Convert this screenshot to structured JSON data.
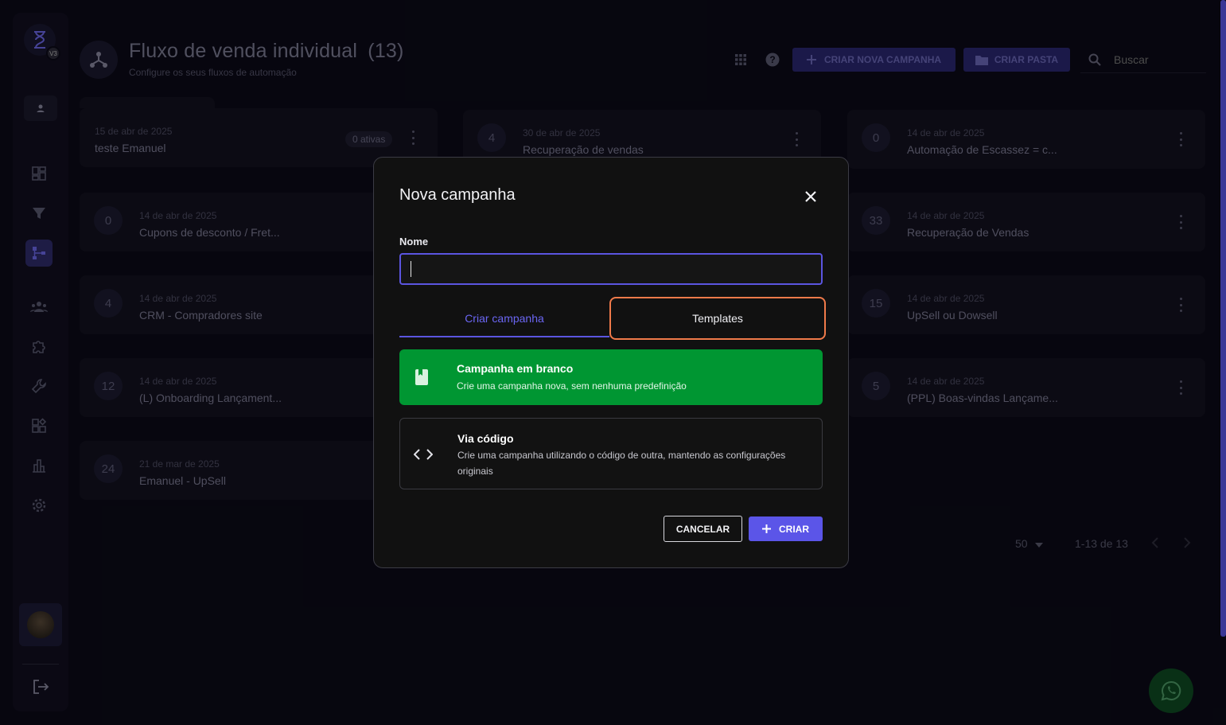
{
  "header": {
    "title": "Fluxo de venda individual",
    "count": "(13)",
    "subtitle": "Configure os seus fluxos de automação",
    "new_campaign_label": "CRIAR NOVA CAMPANHA",
    "new_folder_label": "CRIAR PASTA",
    "search_placeholder": "Buscar"
  },
  "sidebar": {
    "logo_badge": "V3",
    "items": [
      {
        "icon": "dashboard-icon",
        "active": false
      },
      {
        "icon": "funnel-icon",
        "active": false
      },
      {
        "icon": "flow-icon",
        "active": true
      },
      {
        "icon": "people-icon",
        "active": false
      },
      {
        "icon": "puzzle-icon",
        "active": false
      },
      {
        "icon": "wrench-icon",
        "active": false
      },
      {
        "icon": "widgets-icon",
        "active": false
      },
      {
        "icon": "bar-chart-icon",
        "active": false
      },
      {
        "icon": "gear-icon",
        "active": false
      }
    ]
  },
  "cards": [
    {
      "date": "15 de abr de 2025",
      "name": "teste Emanuel",
      "tag": "0 ativas"
    },
    {
      "count": "4",
      "date": "30 de abr de 2025",
      "name": "Recuperação de vendas"
    },
    {
      "count": "0",
      "date": "14 de abr de 2025",
      "name": "Automação de Escassez = c..."
    },
    {
      "count": "0",
      "date": "14 de abr de 2025",
      "name": "Cupons de desconto / Fret..."
    },
    {
      "count": "33",
      "date": "14 de abr de 2025",
      "name": "Recuperação de Vendas"
    },
    {
      "count": "4",
      "date": "14 de abr de 2025",
      "name": "CRM - Compradores site"
    },
    {
      "count": "15",
      "date": "14 de abr de 2025",
      "name": "UpSell ou Dowsell"
    },
    {
      "count": "12",
      "date": "14 de abr de 2025",
      "name": "(L) Onboarding Lançament..."
    },
    {
      "count": "5",
      "date": "14 de abr de 2025",
      "name": "(PPL) Boas-vindas Lançame..."
    },
    {
      "count": "24",
      "date": "21 de mar de 2025",
      "name": "Emanuel - UpSell"
    }
  ],
  "pagination": {
    "per_page": "50",
    "range": "1-13 de 13"
  },
  "modal": {
    "title": "Nova campanha",
    "name_label": "Nome",
    "name_value": "",
    "tab_create": "Criar campanha",
    "tab_templates": "Templates",
    "option_blank_title": "Campanha em branco",
    "option_blank_desc": "Crie uma campanha nova, sem nenhuma predefinição",
    "option_code_title": "Via código",
    "option_code_desc": "Crie uma campanha utilizando o código de outra, mantendo as configurações originais",
    "cancel_label": "CANCELAR",
    "create_label": "CRIAR"
  },
  "colors": {
    "accent": "#5b55e8",
    "highlight": "#f07a4a",
    "success": "#009632",
    "background": "#0b0a17"
  }
}
